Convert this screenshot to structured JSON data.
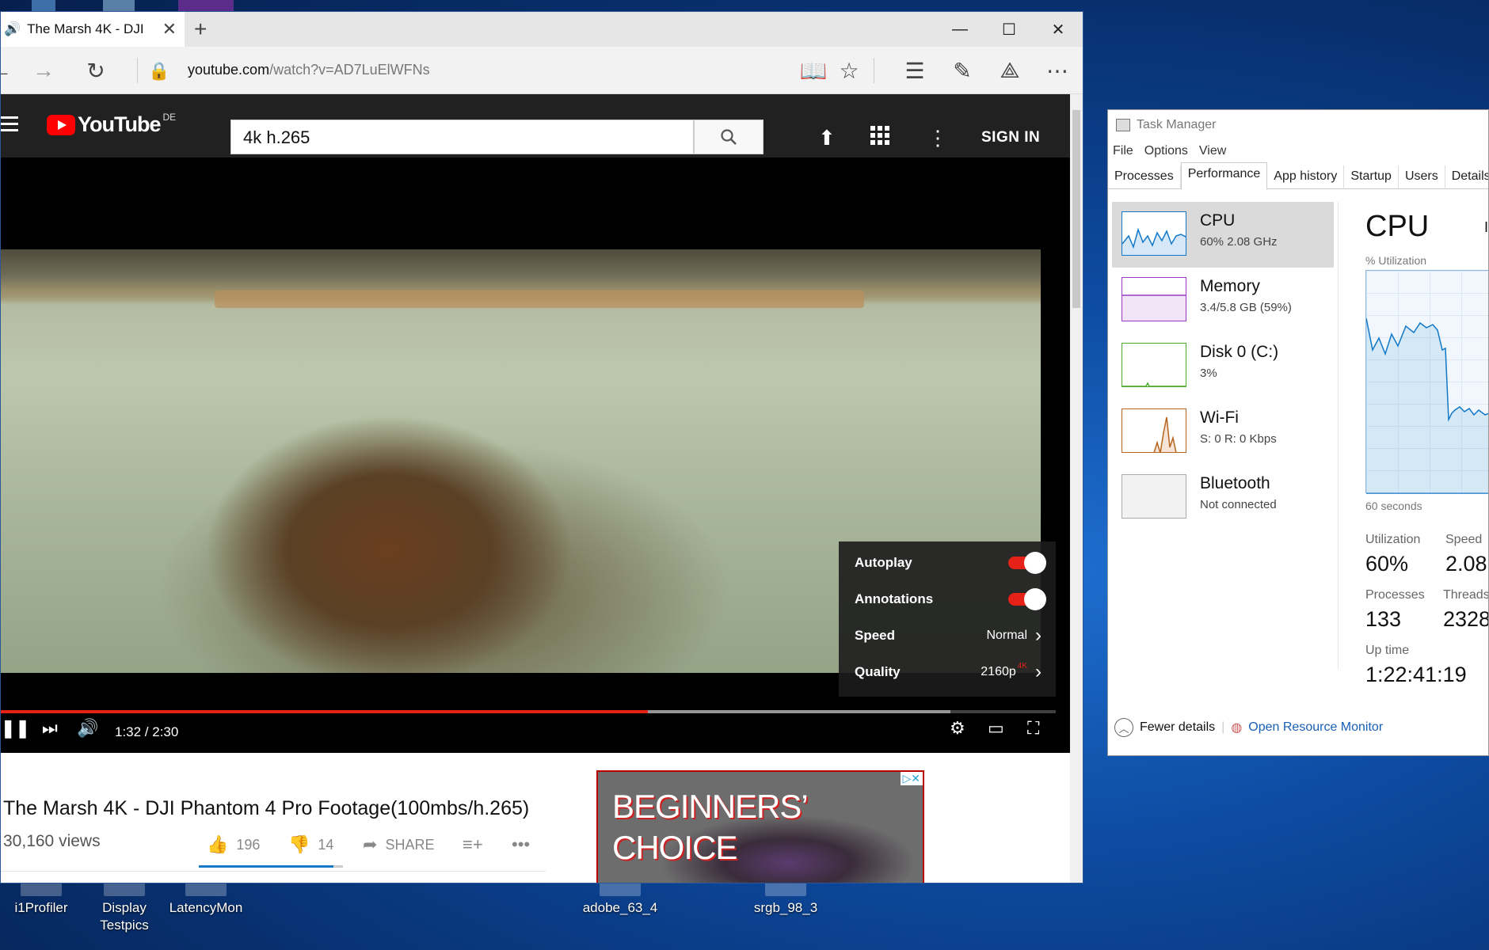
{
  "browser": {
    "tab_title": "The Marsh 4K - DJI",
    "address": {
      "host": "youtube.com",
      "path": "/watch?v=AD7LuElWFNs"
    }
  },
  "youtube": {
    "logo": "YouTube",
    "region": "DE",
    "search_value": "4k h.265",
    "sign_in": "SIGN IN",
    "settings": {
      "autoplay": "Autoplay",
      "annotations": "Annotations",
      "speed_label": "Speed",
      "speed_value": "Normal",
      "quality_label": "Quality",
      "quality_value": "2160p",
      "quality_badge": "4K"
    },
    "player": {
      "time": "1:32 / 2:30",
      "played_fraction": 0.613,
      "buffered_fraction": 0.9
    },
    "video": {
      "title": "The Marsh 4K - DJI Phantom 4 Pro Footage(100mbs/h.265)",
      "views": "30,160 views",
      "likes": "196",
      "dislikes": "14",
      "share": "SHARE"
    },
    "ad": {
      "line1": "BEGINNERS’",
      "line2": "CHOICE"
    }
  },
  "desktop_icons": [
    "i1Profiler",
    "Display Testpics",
    "LatencyMon",
    "adobe_63_4",
    "srgb_98_3"
  ],
  "task_manager": {
    "title": "Task Manager",
    "menu": [
      "File",
      "Options",
      "View"
    ],
    "tabs": [
      "Processes",
      "Performance",
      "App history",
      "Startup",
      "Users",
      "Details"
    ],
    "active_tab": "Performance",
    "resources": [
      {
        "name": "CPU",
        "sub": "60%  2.08 GHz",
        "color": "#1178c8"
      },
      {
        "name": "Memory",
        "sub": "3.4/5.8 GB (59%)",
        "color": "#9b3ac0"
      },
      {
        "name": "Disk 0 (C:)",
        "sub": "3%",
        "color": "#4da82c"
      },
      {
        "name": "Wi-Fi",
        "sub": "S: 0  R: 0 Kbps",
        "color": "#b5651d"
      },
      {
        "name": "Bluetooth",
        "sub": "Not connected",
        "color": "#aaaaaa"
      }
    ],
    "main": {
      "heading": "CPU",
      "heading_right": "I",
      "util_label": "% Utilization",
      "axis_label": "60 seconds",
      "utilization_label": "Utilization",
      "utilization": "60%",
      "speed_label": "Speed",
      "speed": "2.08",
      "processes_label": "Processes",
      "processes": "133",
      "threads_label": "Threads",
      "threads": "2328",
      "uptime_label": "Up time",
      "uptime": "1:22:41:19"
    },
    "footer": {
      "fewer": "Fewer details",
      "monitor": "Open Resource Monitor"
    }
  }
}
